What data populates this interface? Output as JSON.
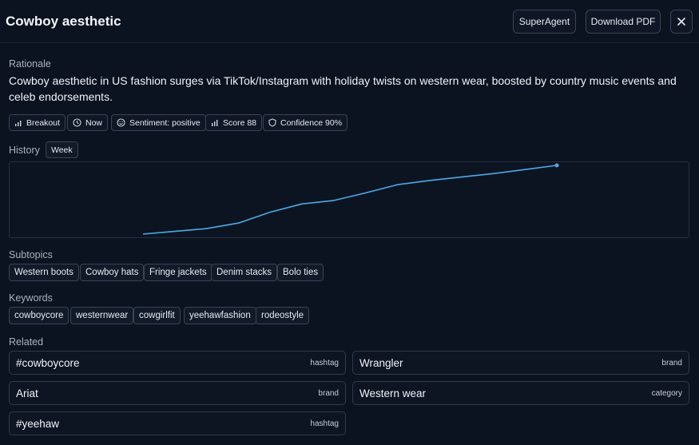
{
  "header": {
    "title": "Cowboy aesthetic",
    "superagent_label": "SuperAgent",
    "download_label": "Download PDF",
    "close_icon": "close-icon"
  },
  "rationale": {
    "label": "Rationale",
    "text": "Cowboy aesthetic in US fashion surges via TikTok/Instagram with holiday twists on western wear, boosted by country music events and celeb endorsements."
  },
  "badges": [
    {
      "label": "Breakout",
      "icon": "bar-chart-icon"
    },
    {
      "label": "Now",
      "icon": "clock-icon"
    },
    {
      "label": "Sentiment: positive",
      "icon": "smiley-icon"
    },
    {
      "label": "Score 88",
      "icon": "signal-icon"
    },
    {
      "label": "Confidence 90%",
      "icon": "shield-icon"
    }
  ],
  "history": {
    "label": "History",
    "period": "Week"
  },
  "chart_data": {
    "type": "line",
    "series": [
      {
        "values": [
          0,
          4,
          8,
          16,
          32,
          44,
          49,
          60,
          72,
          78,
          83,
          88,
          94,
          100
        ]
      }
    ],
    "color": "#4fa9e6",
    "grid": false,
    "title": "",
    "xlabel": "",
    "ylabel": ""
  },
  "subtopics": {
    "label": "Subtopics",
    "items": [
      "Western boots",
      "Cowboy hats",
      "Fringe jackets",
      "Denim stacks",
      "Bolo ties"
    ]
  },
  "keywords": {
    "label": "Keywords",
    "items": [
      "cowboycore",
      "westernwear",
      "cowgirlfit",
      "yeehawfashion",
      "rodeostyle"
    ]
  },
  "related": {
    "label": "Related",
    "items": [
      {
        "name": "#cowboycore",
        "type": "hashtag"
      },
      {
        "name": "Wrangler",
        "type": "brand"
      },
      {
        "name": "Ariat",
        "type": "brand"
      },
      {
        "name": "Western wear",
        "type": "category"
      },
      {
        "name": "#yeehaw",
        "type": "hashtag"
      }
    ]
  }
}
